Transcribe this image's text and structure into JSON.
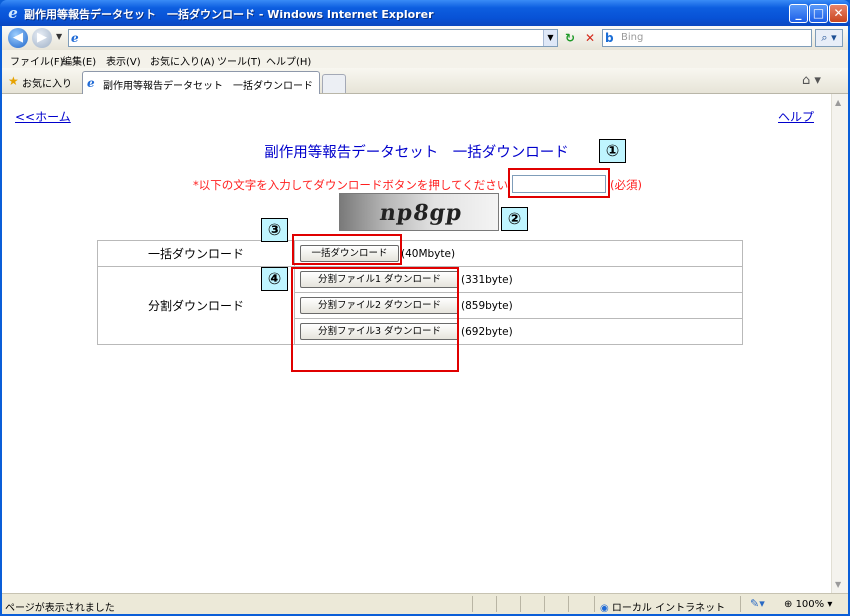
{
  "window": {
    "title": "副作用等報告データセット　一括ダウンロード - Windows Internet Explorer",
    "minimize": "_",
    "maximize": "□",
    "close": "✕"
  },
  "address": {
    "url": "",
    "search_placeholder": "Bing"
  },
  "menu": [
    "ファイル(F)",
    "編集(E)",
    "表示(V)",
    "お気に入り(A)",
    "ツール(T)",
    "ヘルプ(H)"
  ],
  "favorites": {
    "label": "お気に入り",
    "tab_title": "副作用等報告データセット　一括ダウンロード"
  },
  "page": {
    "home_link": "<<ホーム",
    "help_link": "ヘルプ",
    "title": "副作用等報告データセット　一括ダウンロード",
    "instruction": "*以下の文字を入力してダウンロードボタンを押してください",
    "captcha_value": "",
    "required": "(必須)",
    "captcha_text": "np8gp",
    "bulk": {
      "label": "一括ダウンロード",
      "button": "一括ダウンロード",
      "size": "(40Mbyte)"
    },
    "split": {
      "label": "分割ダウンロード",
      "files": [
        {
          "button": "分割ファイル1 ダウンロード",
          "size": "(331byte)"
        },
        {
          "button": "分割ファイル2 ダウンロード",
          "size": "(859byte)"
        },
        {
          "button": "分割ファイル3 ダウンロード",
          "size": "(692byte)"
        }
      ]
    }
  },
  "annotations": [
    "①",
    "②",
    "③",
    "④"
  ],
  "status": {
    "text": "ページが表示されました",
    "zone": "ローカル イントラネット",
    "zoom": "100%"
  }
}
